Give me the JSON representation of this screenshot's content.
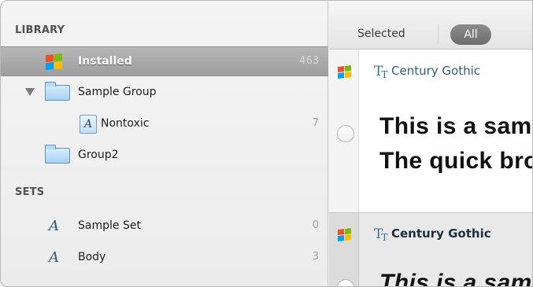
{
  "sidebar": {
    "library_header": "LIBRARY",
    "sets_header": "SETS",
    "library_items": [
      {
        "label": "Installed",
        "count": "463",
        "icon": "windows-logo-icon",
        "selected": true
      },
      {
        "label": "Sample Group",
        "count": "",
        "icon": "folder-icon",
        "expanded": true
      },
      {
        "label": "Nontoxic",
        "count": "7",
        "icon": "font-file-icon"
      },
      {
        "label": "Group2",
        "count": "",
        "icon": "folder-icon"
      }
    ],
    "set_items": [
      {
        "label": "Sample Set",
        "count": "0",
        "icon": "font-set-icon"
      },
      {
        "label": "Body",
        "count": "3",
        "icon": "font-set-icon"
      }
    ]
  },
  "toolbar": {
    "selected_label": "Selected",
    "all_label": "All"
  },
  "fonts": [
    {
      "name": "Century Gothic",
      "sample_lines": [
        "This is a sample",
        "The quick brown fox"
      ]
    },
    {
      "name": "Century Gothic",
      "sample_lines": [
        "This is a sample"
      ]
    }
  ],
  "colors": {
    "windows_red": "#f24f22",
    "windows_green": "#7cbb00",
    "windows_blue": "#00a1f1",
    "windows_yellow": "#ffbb00",
    "selection": "#a5a5a5"
  }
}
